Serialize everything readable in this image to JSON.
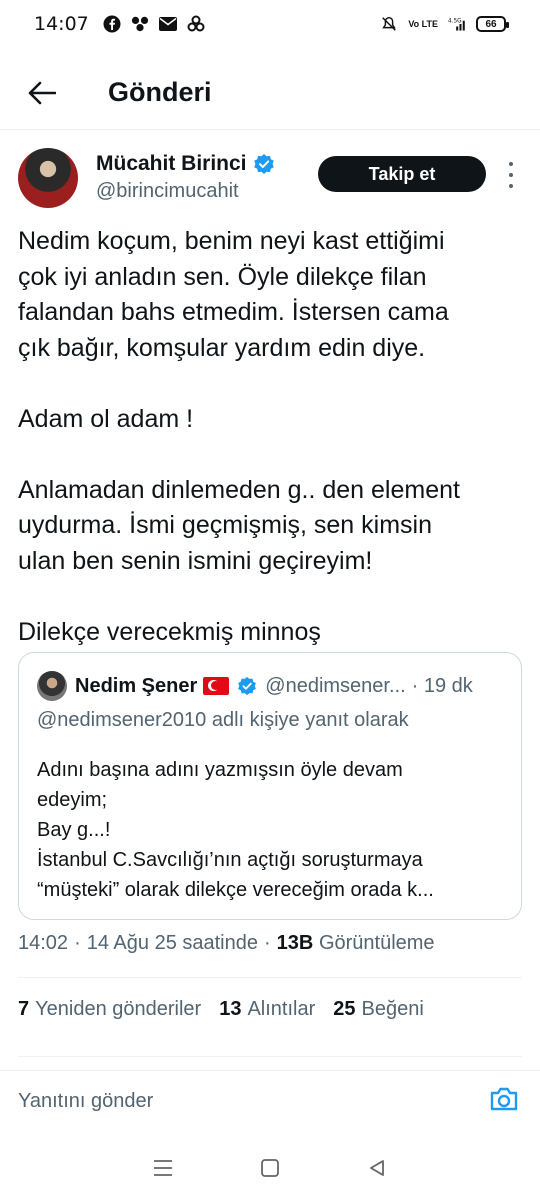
{
  "status_bar": {
    "time": "14:07",
    "network_label": "4.5G",
    "volte_label": "Vo LTE",
    "battery": "66"
  },
  "header": {
    "title": "Gönderi"
  },
  "author": {
    "name": "Mücahit Birinci",
    "handle": "@birincimucahit",
    "follow_label": "Takip et",
    "verified": true
  },
  "tweet": {
    "paragraphs": [
      [
        "Nedim koçum, benim neyi kast ettiğimi",
        "çok iyi anladın sen. Öyle dilekçe filan",
        "falandan bahs etmedim. İstersen cama",
        "çık bağır, komşular yardım edin diye."
      ],
      [
        "Adam ol adam !"
      ],
      [
        "Anlamadan dinlemeden g.. den element",
        "uydurma. İsmi geçmişmiş, sen kimsin",
        "ulan ben senin ismini geçireyim!"
      ],
      [
        "Dilekçe verecekmiş minnoş"
      ]
    ]
  },
  "quote": {
    "name": "Nedim Şener",
    "handle": "@nedimsener...",
    "time": "· 19 dk",
    "reply_to": "@nedimsener2010 adlı kişiye yanıt olarak",
    "lines": [
      "Adını başına adını yazmışsın öyle devam",
      "edeyim;",
      "Bay g...!",
      "İstanbul C.Savcılığı’nın açtığı soruşturmaya",
      "“müşteki” olarak dilekçe vereceğim orada k..."
    ]
  },
  "meta": {
    "time": "14:02",
    "separator1": "·",
    "date": "14 Ağu 25 saatinde",
    "separator2": "·",
    "views_count": "13B",
    "views_label": "Görüntüleme"
  },
  "stats": {
    "reposts_count": "7",
    "reposts_label": "Yeniden gönderiler",
    "quotes_count": "13",
    "quotes_label": "Alıntılar",
    "likes_count": "25",
    "likes_label": "Beğeni"
  },
  "reply": {
    "placeholder": "Yanıtını gönder"
  },
  "colors": {
    "accent": "#1d9bf0",
    "text": "#0f1419",
    "secondary": "#536471",
    "border": "#cfd9de"
  }
}
